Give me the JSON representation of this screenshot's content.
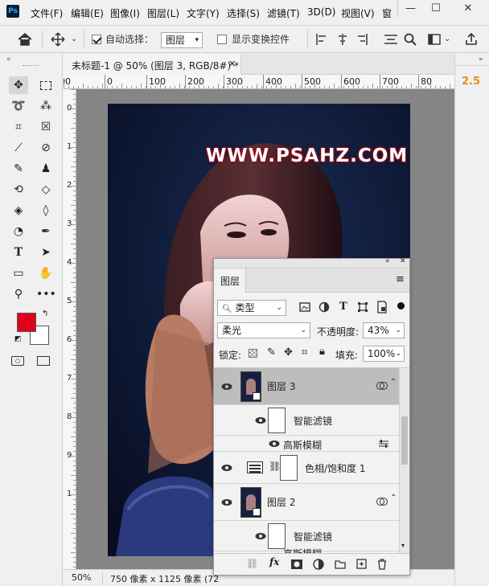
{
  "app": {
    "logo": "Ps"
  },
  "menu": [
    "文件(F)",
    "编辑(E)",
    "图像(I)",
    "图层(L)",
    "文字(Y)",
    "选择(S)",
    "滤镜(T)",
    "3D(D)",
    "视图(V)",
    "窗"
  ],
  "window_controls": {
    "minimize": "—",
    "maximize": "☐",
    "close": "✕"
  },
  "options": {
    "auto_select_label": "自动选择：",
    "auto_select_checked": true,
    "auto_select_target": "图层",
    "show_transform_label": "显示变换控件",
    "show_transform_checked": false
  },
  "document": {
    "tab_title": "未标题-1 @ 50% (图层 3, RGB/8#) *",
    "ruler_h_ticks": [
      "00",
      "0",
      "100",
      "200",
      "300",
      "400",
      "500",
      "600",
      "700",
      "80"
    ],
    "ruler_v_ticks": [
      "0",
      "1",
      "2",
      "3",
      "4",
      "5",
      "6",
      "7",
      "8",
      "9",
      "1"
    ],
    "watermark": "WWW.PSAHZ.COM"
  },
  "status": {
    "zoom": "50%",
    "info": "750 像素 x 1125 像素 (72"
  },
  "right_panel": {
    "value": "2.5"
  },
  "colors": {
    "foreground": "#e3001b",
    "background": "#ffffff",
    "accent_orange": "#e8901a",
    "watermark_text": "#ffffff",
    "watermark_outline": "#8a0a1a"
  },
  "layers_panel": {
    "tab": "图层",
    "filter_type": "类型",
    "blend_mode": "柔光",
    "opacity_label": "不透明度:",
    "opacity": "43%",
    "lock_label": "锁定:",
    "fill_label": "填充:",
    "fill": "100%",
    "layers": [
      {
        "name": "图层 3",
        "selected": true,
        "smart_filter_label": "智能滤镜",
        "filter": "高斯模糊"
      },
      {
        "name": "色相/饱和度 1",
        "adjustment": true
      },
      {
        "name": "图层 2",
        "selected": false,
        "smart_filter_label": "智能滤镜",
        "filter": "高斯模糊"
      }
    ],
    "bottom_icons": [
      "link-icon",
      "fx-icon",
      "mask-icon",
      "adjustment-icon",
      "folder-icon",
      "new-layer-icon",
      "trash-icon"
    ]
  }
}
